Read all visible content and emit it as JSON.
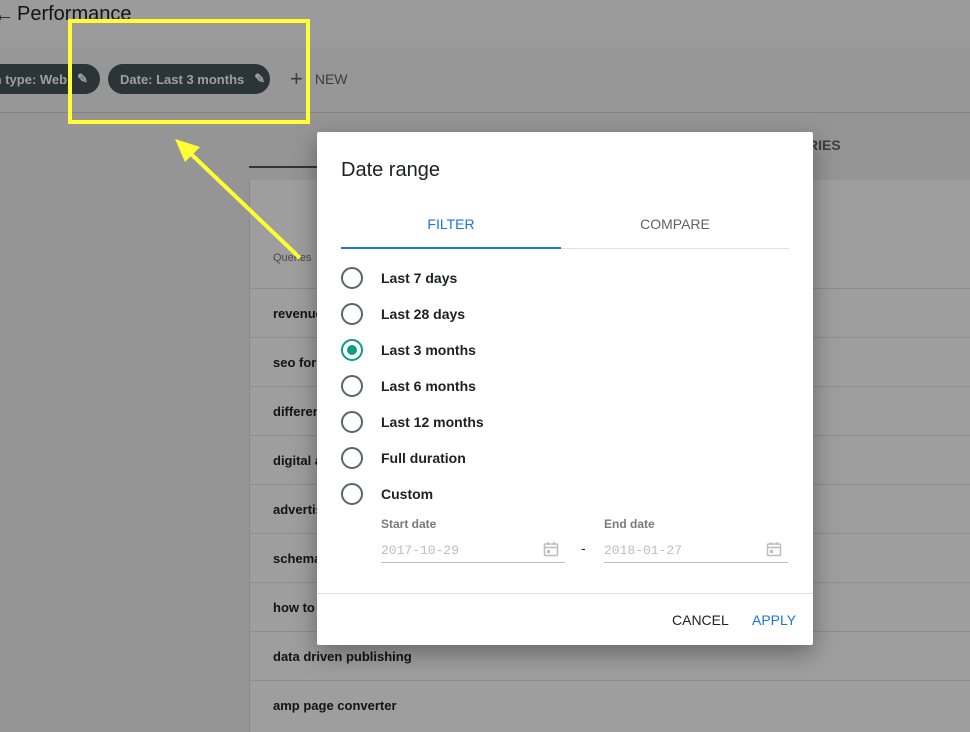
{
  "page": {
    "title": "Performance",
    "back_icon": "arrow-back-icon"
  },
  "filters": {
    "search_type_chip": "h type: Web",
    "date_chip": "Date: Last 3 months",
    "new_label": "NEW"
  },
  "report": {
    "countries_tab": "RIES",
    "queries_header": "Queries",
    "rows": [
      "revenue",
      "seo for",
      "differen",
      "digital a",
      "advertis",
      "schema",
      "how to",
      "data driven publishing",
      "amp page converter"
    ]
  },
  "dialog": {
    "title": "Date range",
    "tabs": [
      "FILTER",
      "COMPARE"
    ],
    "active_tab": "FILTER",
    "options": [
      "Last 7 days",
      "Last 28 days",
      "Last 3 months",
      "Last 6 months",
      "Last 12 months",
      "Full duration",
      "Custom"
    ],
    "selected_option": "Last 3 months",
    "start_date_label": "Start date",
    "start_date_value": "2017-10-29",
    "end_date_label": "End date",
    "end_date_value": "2018-01-27",
    "date_separator": "-",
    "cancel_label": "CANCEL",
    "apply_label": "APPLY"
  },
  "colors": {
    "accent": "#1a73e8",
    "radio_selected": "#0f9d7f",
    "chip_bg": "#45545c",
    "annotation": "#ffff33"
  }
}
